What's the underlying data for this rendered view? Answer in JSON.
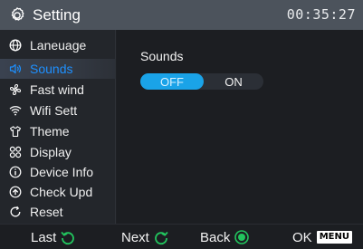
{
  "header": {
    "title": "Setting",
    "icon": "gear-icon",
    "clock": "00:35:27"
  },
  "sidebar": {
    "items": [
      {
        "label": "Laneuage",
        "icon": "globe-icon"
      },
      {
        "label": "Sounds",
        "icon": "speaker-icon",
        "active": true
      },
      {
        "label": "Fast wind",
        "icon": "fan-icon"
      },
      {
        "label": "Wifi Sett",
        "icon": "wifi-icon"
      },
      {
        "label": "Theme",
        "icon": "shirt-icon"
      },
      {
        "label": "Display",
        "icon": "grid-icon"
      },
      {
        "label": "Device Info",
        "icon": "info-icon"
      },
      {
        "label": "Check Upd",
        "icon": "upload-icon"
      },
      {
        "label": "Reset",
        "icon": "reset-icon"
      }
    ]
  },
  "main": {
    "sounds_label": "Sounds",
    "toggle": {
      "off_label": "OFF",
      "on_label": "ON",
      "selected": "OFF"
    }
  },
  "footer": {
    "last_label": "Last",
    "next_label": "Next",
    "back_label": "Back",
    "ok_label": "OK",
    "menu_key": "MENU"
  },
  "colors": {
    "accent": "#1e90ff",
    "toggle_active": "#1aa3e8",
    "footer_icon": "#22c55e",
    "header_bg": "#4c535c"
  }
}
